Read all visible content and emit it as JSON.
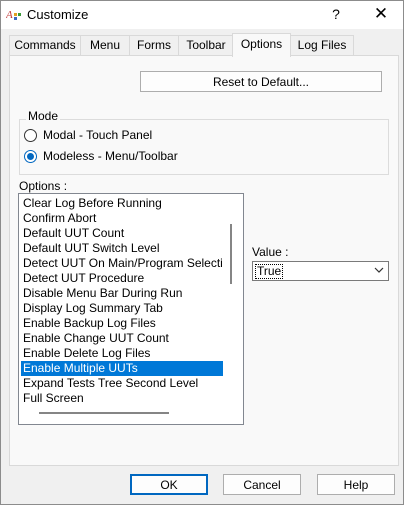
{
  "window": {
    "title": "Customize",
    "help_glyph": "?",
    "close_glyph": "✕"
  },
  "tabs": [
    {
      "label": "Commands"
    },
    {
      "label": "Menu"
    },
    {
      "label": "Forms"
    },
    {
      "label": "Toolbar"
    },
    {
      "label": "Options",
      "active": true
    },
    {
      "label": "Log Files"
    }
  ],
  "reset_button": {
    "label": "Reset to Default..."
  },
  "mode": {
    "label": "Mode",
    "options": [
      {
        "label": "Modal - Touch Panel",
        "checked": false
      },
      {
        "label": "Modeless - Menu/Toolbar",
        "checked": true
      }
    ]
  },
  "options_list": {
    "label": "Options :",
    "items": [
      "Clear Log Before Running",
      "Confirm Abort",
      "Default UUT Count",
      "Default UUT Switch Level",
      "Detect UUT On Main/Program Selection F",
      "Detect UUT Procedure",
      "Disable Menu Bar During Run",
      "Display Log Summary Tab",
      "Enable Backup Log Files",
      "Enable Change UUT Count",
      "Enable Delete Log Files",
      "Enable Multiple UUTs",
      "Expand Tests Tree Second Level",
      "Full Screen"
    ],
    "selected": "Enable Multiple UUTs"
  },
  "value": {
    "label": "Value :",
    "selected": "True"
  },
  "footer": {
    "ok": "OK",
    "cancel": "Cancel",
    "help": "Help"
  },
  "colors": {
    "accent": "#0067c0",
    "selection": "#0078d7"
  }
}
